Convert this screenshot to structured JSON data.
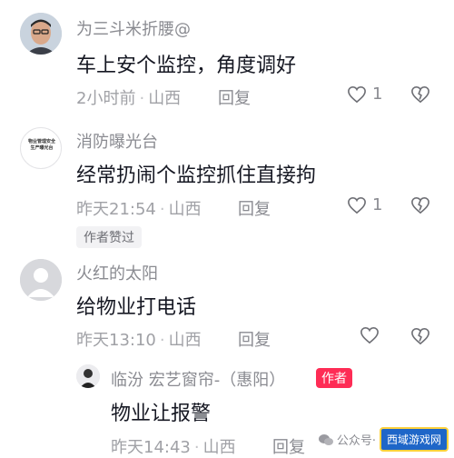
{
  "comments": [
    {
      "username": "为三斗米折腰@",
      "content": "车上安个监控，角度调好",
      "time": "2小时前",
      "location": "山西",
      "reply_label": "回复",
      "like_count": "1"
    },
    {
      "username": "消防曝光台",
      "avatar_text": "物业管理安全生产曝光台",
      "content": "经常扔闹个监控抓住直接拘",
      "time": "昨天21:54",
      "location": "山西",
      "reply_label": "回复",
      "like_count": "1",
      "author_liked": "作者赞过"
    },
    {
      "username": "火红的太阳",
      "content": "给物业打电话",
      "time": "昨天13:10",
      "location": "山西",
      "reply_label": "回复"
    },
    {
      "username": "临汾 宏艺窗帘-（惠阳）",
      "badge": "作者",
      "content": "物业让报警",
      "time": "昨天14:43",
      "location": "山西",
      "reply_label": "回复"
    }
  ],
  "watermark": {
    "text": "公众号·",
    "badge": "西域游戏网"
  }
}
